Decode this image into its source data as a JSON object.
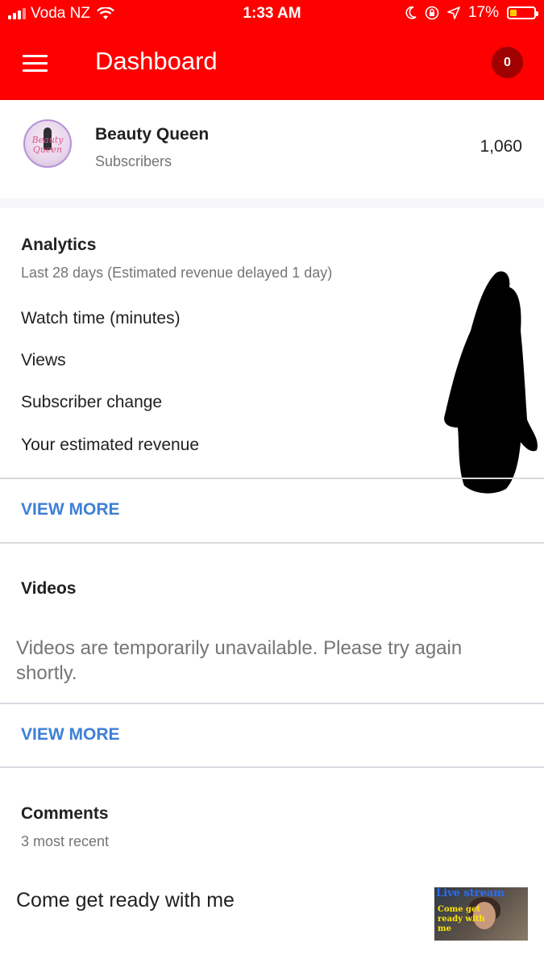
{
  "status_bar": {
    "carrier": "Voda NZ",
    "time": "1:33 AM",
    "battery": "17%",
    "icons": [
      "signal-icon",
      "wifi-icon",
      "moon-icon",
      "rotation-lock-icon",
      "location-arrow-icon",
      "battery-icon"
    ]
  },
  "app_bar": {
    "title": "Dashboard",
    "notification_count": "0",
    "color": "#ff0000"
  },
  "channel": {
    "name": "Beauty Queen",
    "subscribers_label": "Subscribers",
    "subscribers_count": "1,060",
    "avatar_text_line1": "Beauty",
    "avatar_text_line2": "Queen"
  },
  "analytics": {
    "title": "Analytics",
    "subtitle": "Last 28 days (Estimated revenue delayed 1 day)",
    "metrics": [
      "Watch time (minutes)",
      "Views",
      "Subscriber change",
      "Your estimated revenue"
    ],
    "view_more": "VIEW MORE"
  },
  "videos": {
    "title": "Videos",
    "message": "Videos are temporarily unavailable. Please try again shortly.",
    "view_more": "VIEW MORE"
  },
  "comments": {
    "title": "Comments",
    "subtitle": "3 most recent",
    "items": [
      {
        "text": "Come get ready with me",
        "thumbnail_title": "Live stream",
        "thumbnail_caption": "Come get ready with me"
      }
    ]
  },
  "colors": {
    "accent_link": "#3d7fd6",
    "text_primary": "#212121",
    "text_secondary": "#757575"
  }
}
